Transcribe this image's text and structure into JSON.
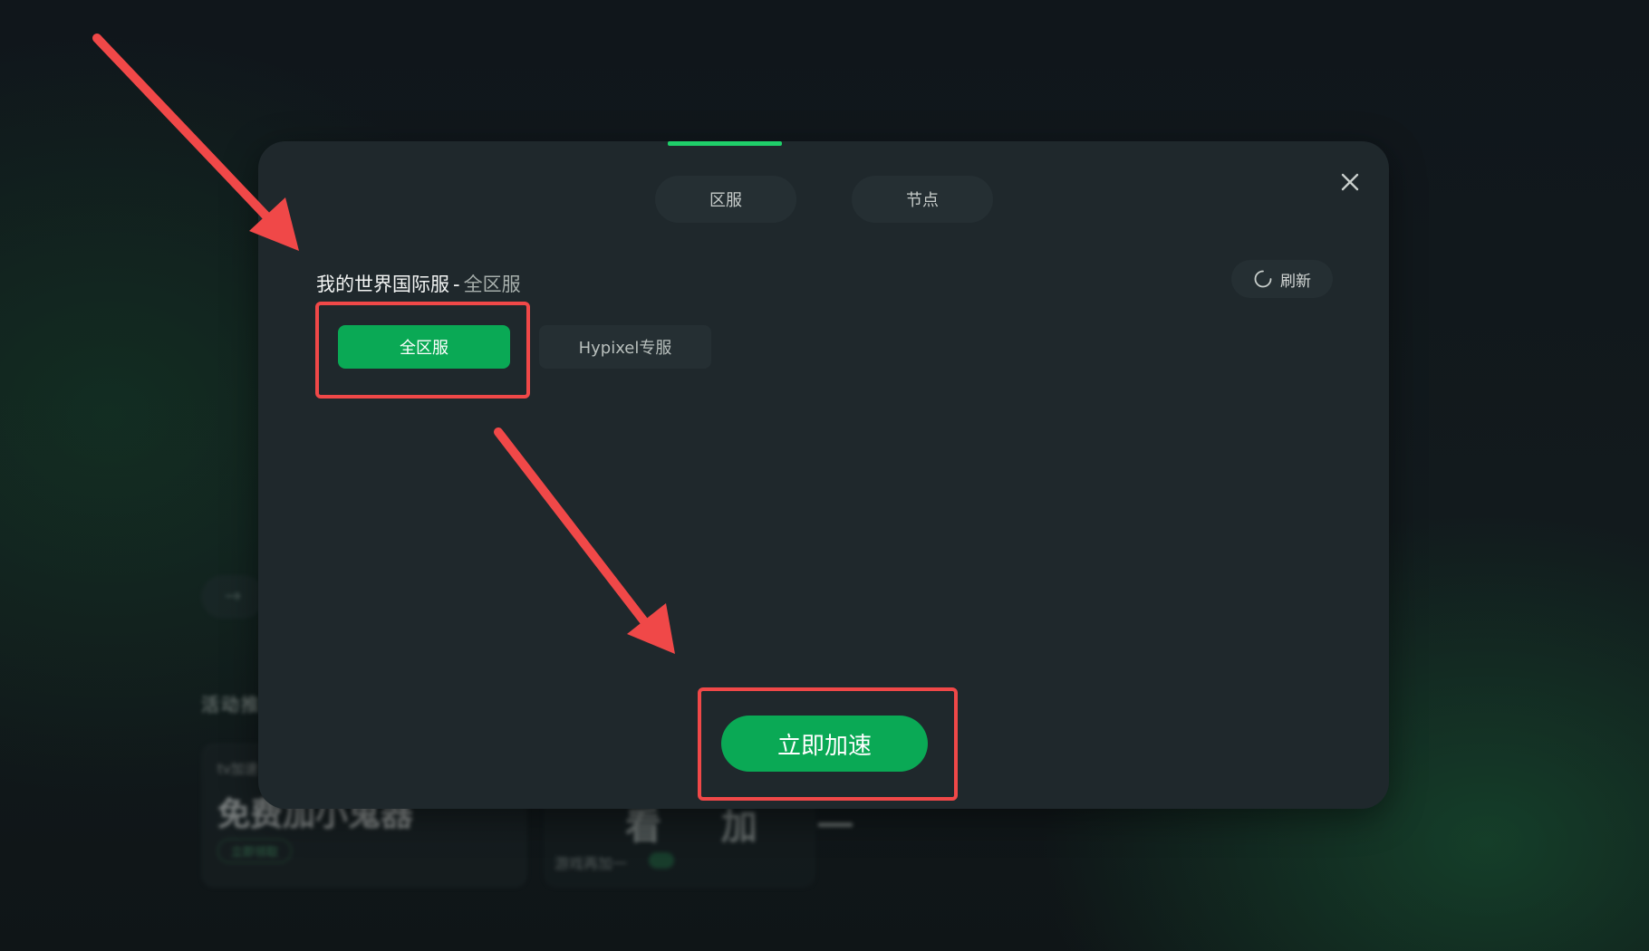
{
  "background": {
    "section_title": "活动推荐",
    "card1": {
      "small_text": "tv加速",
      "big_text": "免费加小鬼器",
      "pill_text": "立即领取"
    },
    "card2": {
      "big_text": "看 加 一",
      "small_text": "游戏再加一"
    }
  },
  "modal": {
    "tabs": [
      {
        "label": "区服",
        "active": true
      },
      {
        "label": "节点",
        "active": false
      }
    ],
    "game_title": "我的世界国际服",
    "separator": "-",
    "current_server": "全区服",
    "refresh_label": "刷新",
    "servers": [
      {
        "label": "全区服",
        "selected": true
      },
      {
        "label": "Hypixel专服",
        "selected": false
      }
    ],
    "accelerate_label": "立即加速"
  },
  "colors": {
    "accent": "#0aa955",
    "indicator": "#1fcf6a",
    "modal_bg": "#1f282c",
    "highlight": "#f04848"
  },
  "icons": {
    "close": "close-icon",
    "refresh": "refresh-icon"
  }
}
